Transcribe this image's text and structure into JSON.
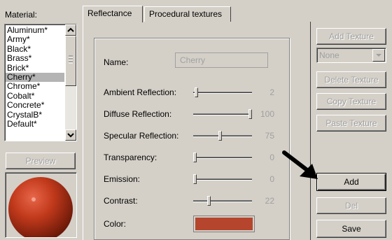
{
  "material_panel": {
    "label": "Material:",
    "items": [
      "Aluminum*",
      "Army*",
      "Black*",
      "Brass*",
      "Brick*",
      "Cherry*",
      "Chrome*",
      "Cobalt*",
      "Concrete*",
      "CrystalB*",
      "Default*"
    ],
    "selected": "Cherry*",
    "preview_label": "Preview"
  },
  "tabs": {
    "reflectance": "Reflectance",
    "procedural": "Procedural textures"
  },
  "form": {
    "name_label": "Name:",
    "name_value": "Cherry",
    "properties": [
      {
        "label": "Ambient Reflection:",
        "value": "2",
        "level": 0.02
      },
      {
        "label": "Diffuse Reflection:",
        "value": "100",
        "level": 1.0
      },
      {
        "label": "Specular Reflection:",
        "value": "75",
        "level": 0.45
      },
      {
        "label": "Transparency:",
        "value": "0",
        "level": 0.0
      },
      {
        "label": "Emission:",
        "value": "0",
        "level": 0.0
      },
      {
        "label": "Contrast:",
        "value": "22",
        "level": 0.25
      }
    ],
    "color_label": "Color:",
    "color_value": "#b5452d"
  },
  "texture_buttons": {
    "add_texture": "Add Texture",
    "dropdown_value": "None",
    "delete_texture": "Delete Texture",
    "copy_texture": "Copy Texture",
    "paste_texture": "Paste Texture"
  },
  "actions": {
    "add": "Add",
    "del": "Del",
    "save": "Save"
  },
  "colors": {
    "face": "#d4d0c8",
    "sphere": "#c23a1c",
    "swatch": "#b5452d",
    "disabled_text": "#a0a0a0"
  }
}
